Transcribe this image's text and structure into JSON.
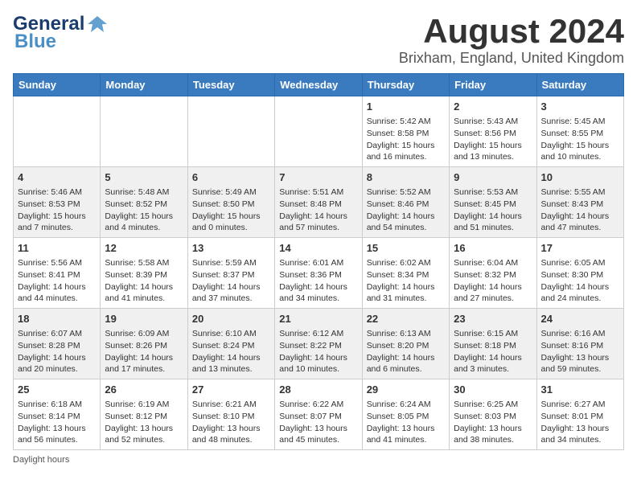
{
  "header": {
    "logo_general": "General",
    "logo_blue": "Blue",
    "month_title": "August 2024",
    "location": "Brixham, England, United Kingdom"
  },
  "days_of_week": [
    "Sunday",
    "Monday",
    "Tuesday",
    "Wednesday",
    "Thursday",
    "Friday",
    "Saturday"
  ],
  "weeks": [
    [
      {
        "day": "",
        "info": ""
      },
      {
        "day": "",
        "info": ""
      },
      {
        "day": "",
        "info": ""
      },
      {
        "day": "",
        "info": ""
      },
      {
        "day": "1",
        "info": "Sunrise: 5:42 AM\nSunset: 8:58 PM\nDaylight: 15 hours\nand 16 minutes."
      },
      {
        "day": "2",
        "info": "Sunrise: 5:43 AM\nSunset: 8:56 PM\nDaylight: 15 hours\nand 13 minutes."
      },
      {
        "day": "3",
        "info": "Sunrise: 5:45 AM\nSunset: 8:55 PM\nDaylight: 15 hours\nand 10 minutes."
      }
    ],
    [
      {
        "day": "4",
        "info": "Sunrise: 5:46 AM\nSunset: 8:53 PM\nDaylight: 15 hours\nand 7 minutes."
      },
      {
        "day": "5",
        "info": "Sunrise: 5:48 AM\nSunset: 8:52 PM\nDaylight: 15 hours\nand 4 minutes."
      },
      {
        "day": "6",
        "info": "Sunrise: 5:49 AM\nSunset: 8:50 PM\nDaylight: 15 hours\nand 0 minutes."
      },
      {
        "day": "7",
        "info": "Sunrise: 5:51 AM\nSunset: 8:48 PM\nDaylight: 14 hours\nand 57 minutes."
      },
      {
        "day": "8",
        "info": "Sunrise: 5:52 AM\nSunset: 8:46 PM\nDaylight: 14 hours\nand 54 minutes."
      },
      {
        "day": "9",
        "info": "Sunrise: 5:53 AM\nSunset: 8:45 PM\nDaylight: 14 hours\nand 51 minutes."
      },
      {
        "day": "10",
        "info": "Sunrise: 5:55 AM\nSunset: 8:43 PM\nDaylight: 14 hours\nand 47 minutes."
      }
    ],
    [
      {
        "day": "11",
        "info": "Sunrise: 5:56 AM\nSunset: 8:41 PM\nDaylight: 14 hours\nand 44 minutes."
      },
      {
        "day": "12",
        "info": "Sunrise: 5:58 AM\nSunset: 8:39 PM\nDaylight: 14 hours\nand 41 minutes."
      },
      {
        "day": "13",
        "info": "Sunrise: 5:59 AM\nSunset: 8:37 PM\nDaylight: 14 hours\nand 37 minutes."
      },
      {
        "day": "14",
        "info": "Sunrise: 6:01 AM\nSunset: 8:36 PM\nDaylight: 14 hours\nand 34 minutes."
      },
      {
        "day": "15",
        "info": "Sunrise: 6:02 AM\nSunset: 8:34 PM\nDaylight: 14 hours\nand 31 minutes."
      },
      {
        "day": "16",
        "info": "Sunrise: 6:04 AM\nSunset: 8:32 PM\nDaylight: 14 hours\nand 27 minutes."
      },
      {
        "day": "17",
        "info": "Sunrise: 6:05 AM\nSunset: 8:30 PM\nDaylight: 14 hours\nand 24 minutes."
      }
    ],
    [
      {
        "day": "18",
        "info": "Sunrise: 6:07 AM\nSunset: 8:28 PM\nDaylight: 14 hours\nand 20 minutes."
      },
      {
        "day": "19",
        "info": "Sunrise: 6:09 AM\nSunset: 8:26 PM\nDaylight: 14 hours\nand 17 minutes."
      },
      {
        "day": "20",
        "info": "Sunrise: 6:10 AM\nSunset: 8:24 PM\nDaylight: 14 hours\nand 13 minutes."
      },
      {
        "day": "21",
        "info": "Sunrise: 6:12 AM\nSunset: 8:22 PM\nDaylight: 14 hours\nand 10 minutes."
      },
      {
        "day": "22",
        "info": "Sunrise: 6:13 AM\nSunset: 8:20 PM\nDaylight: 14 hours\nand 6 minutes."
      },
      {
        "day": "23",
        "info": "Sunrise: 6:15 AM\nSunset: 8:18 PM\nDaylight: 14 hours\nand 3 minutes."
      },
      {
        "day": "24",
        "info": "Sunrise: 6:16 AM\nSunset: 8:16 PM\nDaylight: 13 hours\nand 59 minutes."
      }
    ],
    [
      {
        "day": "25",
        "info": "Sunrise: 6:18 AM\nSunset: 8:14 PM\nDaylight: 13 hours\nand 56 minutes."
      },
      {
        "day": "26",
        "info": "Sunrise: 6:19 AM\nSunset: 8:12 PM\nDaylight: 13 hours\nand 52 minutes."
      },
      {
        "day": "27",
        "info": "Sunrise: 6:21 AM\nSunset: 8:10 PM\nDaylight: 13 hours\nand 48 minutes."
      },
      {
        "day": "28",
        "info": "Sunrise: 6:22 AM\nSunset: 8:07 PM\nDaylight: 13 hours\nand 45 minutes."
      },
      {
        "day": "29",
        "info": "Sunrise: 6:24 AM\nSunset: 8:05 PM\nDaylight: 13 hours\nand 41 minutes."
      },
      {
        "day": "30",
        "info": "Sunrise: 6:25 AM\nSunset: 8:03 PM\nDaylight: 13 hours\nand 38 minutes."
      },
      {
        "day": "31",
        "info": "Sunrise: 6:27 AM\nSunset: 8:01 PM\nDaylight: 13 hours\nand 34 minutes."
      }
    ]
  ],
  "footer": {
    "note": "Daylight hours"
  }
}
